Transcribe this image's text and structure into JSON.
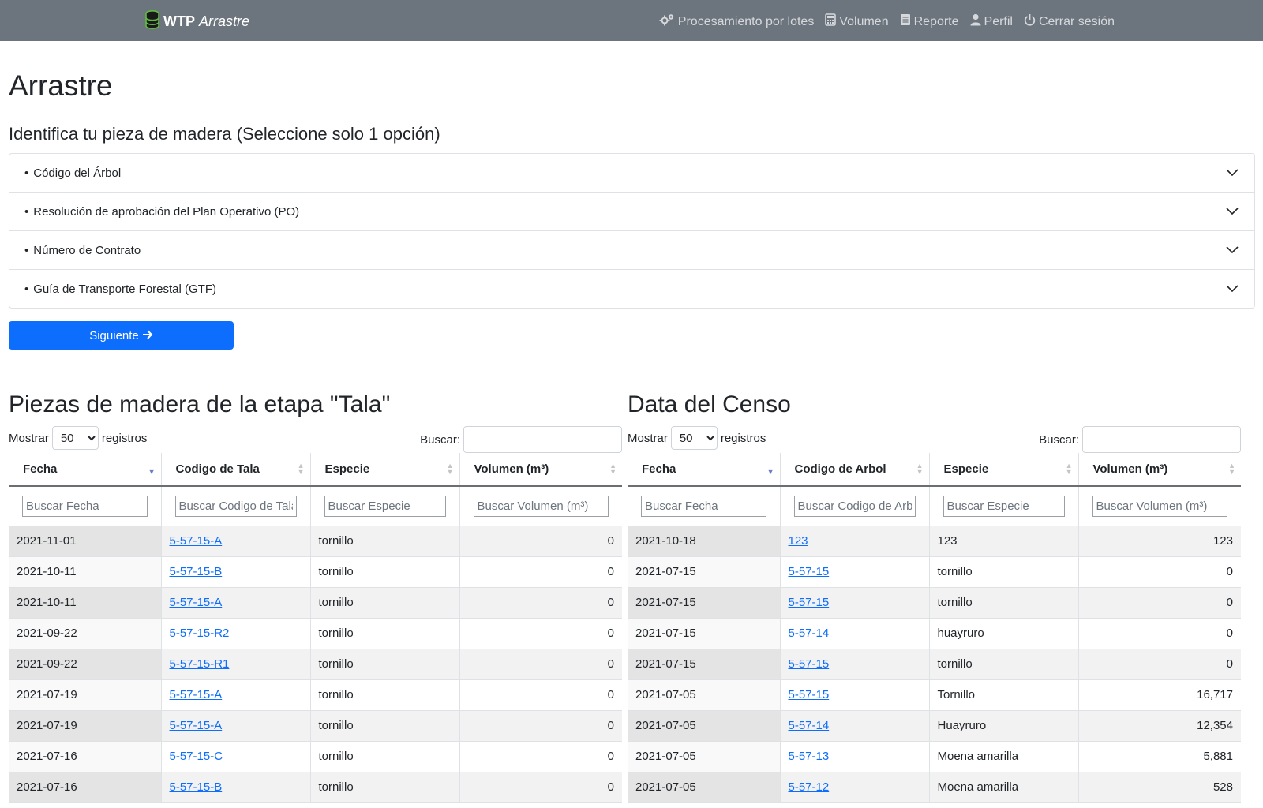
{
  "navbar": {
    "brand_bold": "WTP",
    "brand_italic": "Arrastre",
    "items": [
      {
        "label": "Procesamiento por lotes",
        "icon": "cogs-icon"
      },
      {
        "label": "Volumen",
        "icon": "calculator-icon"
      },
      {
        "label": "Reporte",
        "icon": "book-icon"
      },
      {
        "label": "Perfil",
        "icon": "user-icon"
      },
      {
        "label": "Cerrar sesión",
        "icon": "power-icon"
      }
    ]
  },
  "page": {
    "title": "Arrastre",
    "subtitle": "Identifica tu pieza de madera (Seleccione solo 1 opción)"
  },
  "accordion": [
    {
      "label": "Código del Árbol"
    },
    {
      "label": "Resolución de aprobación del Plan Operativo (PO)"
    },
    {
      "label": "Número de Contrato"
    },
    {
      "label": "Guía de Transporte Forestal (GTF)"
    }
  ],
  "next_button": {
    "label": "Siguiente"
  },
  "tala": {
    "title": "Piezas de madera de la etapa \"Tala\"",
    "show_label": "Mostrar",
    "show_value": "50",
    "records_label": "registros",
    "search_label": "Buscar:",
    "columns": [
      "Fecha",
      "Codigo de Tala",
      "Especie",
      "Volumen (m³)"
    ],
    "filters": [
      "Buscar Fecha",
      "Buscar Codigo de Tala",
      "Buscar Especie",
      "Buscar Volumen (m³)"
    ],
    "rows": [
      [
        "2021-11-01",
        "5-57-15-A",
        "tornillo",
        "0"
      ],
      [
        "2021-10-11",
        "5-57-15-B",
        "tornillo",
        "0"
      ],
      [
        "2021-10-11",
        "5-57-15-A",
        "tornillo",
        "0"
      ],
      [
        "2021-09-22",
        "5-57-15-R2",
        "tornillo",
        "0"
      ],
      [
        "2021-09-22",
        "5-57-15-R1",
        "tornillo",
        "0"
      ],
      [
        "2021-07-19",
        "5-57-15-A",
        "tornillo",
        "0"
      ],
      [
        "2021-07-19",
        "5-57-15-A",
        "tornillo",
        "0"
      ],
      [
        "2021-07-16",
        "5-57-15-C",
        "tornillo",
        "0"
      ],
      [
        "2021-07-16",
        "5-57-15-B",
        "tornillo",
        "0"
      ]
    ]
  },
  "censo": {
    "title": "Data del Censo",
    "show_label": "Mostrar",
    "show_value": "50",
    "records_label": "registros",
    "search_label": "Buscar:",
    "columns": [
      "Fecha",
      "Codigo de Arbol",
      "Especie",
      "Volumen (m³)"
    ],
    "filters": [
      "Buscar Fecha",
      "Buscar Codigo de Arbol",
      "Buscar Especie",
      "Buscar Volumen (m³)"
    ],
    "rows": [
      [
        "2021-10-18",
        "123",
        "123",
        "123"
      ],
      [
        "2021-07-15",
        "5-57-15",
        "tornillo",
        "0"
      ],
      [
        "2021-07-15",
        "5-57-15",
        "tornillo",
        "0"
      ],
      [
        "2021-07-15",
        "5-57-14",
        "huayruro",
        "0"
      ],
      [
        "2021-07-15",
        "5-57-15",
        "tornillo",
        "0"
      ],
      [
        "2021-07-05",
        "5-57-15",
        "Tornillo",
        "16,717"
      ],
      [
        "2021-07-05",
        "5-57-14",
        "Huayruro",
        "12,354"
      ],
      [
        "2021-07-05",
        "5-57-13",
        "Moena amarilla",
        "5,881"
      ],
      [
        "2021-07-05",
        "5-57-12",
        "Moena amarilla",
        "528"
      ]
    ]
  }
}
